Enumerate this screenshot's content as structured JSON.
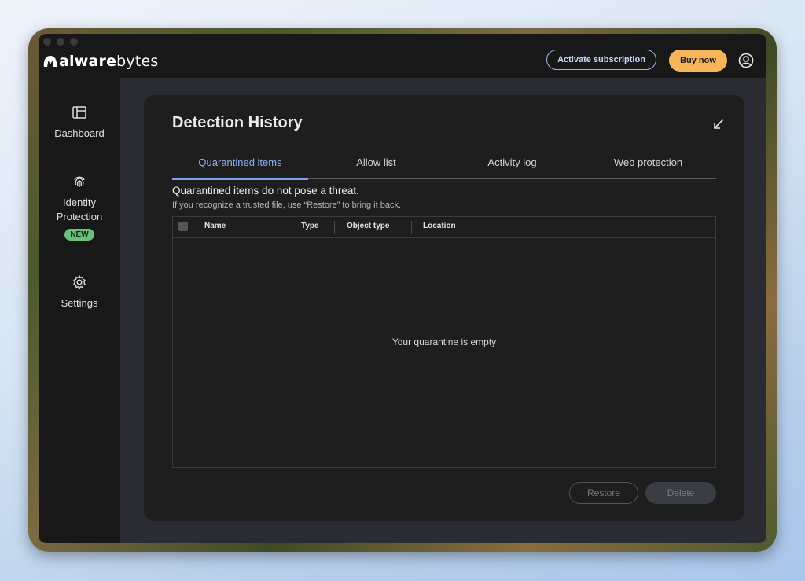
{
  "app": {
    "brand_bold": "alware",
    "brand_light": "bytes",
    "logo_icon": "malwarebytes-m-logo"
  },
  "header": {
    "activate_label": "Activate subscription",
    "buy_label": "Buy now",
    "account_icon": "user-account-icon"
  },
  "sidebar": {
    "items": [
      {
        "label": "Dashboard",
        "icon": "dashboard-icon"
      },
      {
        "label": "Identity Protection",
        "icon": "fingerprint-icon",
        "badge": "NEW"
      },
      {
        "label": "Settings",
        "icon": "gear-icon"
      }
    ]
  },
  "page": {
    "title": "Detection History",
    "collapse_icon": "arrow-down-left-icon"
  },
  "tabs": [
    {
      "label": "Quarantined items",
      "active": true
    },
    {
      "label": "Allow list",
      "active": false
    },
    {
      "label": "Activity log",
      "active": false
    },
    {
      "label": "Web protection",
      "active": false
    }
  ],
  "info": {
    "title": "Quarantined items do not pose a threat.",
    "subtitle": "If you recognize a trusted file, use “Restore” to bring it back."
  },
  "table": {
    "columns": [
      "Name",
      "Type",
      "Object type",
      "Location"
    ],
    "empty_message": "Your quarantine is empty"
  },
  "actions": {
    "restore_label": "Restore",
    "delete_label": "Delete"
  },
  "colors": {
    "accent": "#8fb0f2",
    "buy_button": "#f7b55a",
    "badge_new": "#6cc07a"
  }
}
